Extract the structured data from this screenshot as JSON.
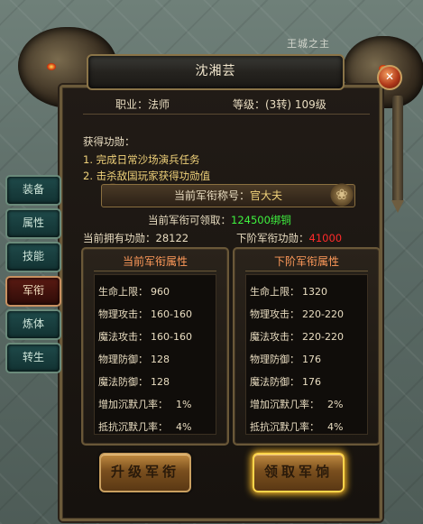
{
  "background": {
    "faint_text": "王城之主"
  },
  "window": {
    "title": "沈湘芸",
    "close_symbol": "✕"
  },
  "character": {
    "job_label": "职业：法师",
    "level_label": "等级：(3转) 109级"
  },
  "merit_gain": {
    "title": "获得功勋：",
    "items": [
      "1. 完成日常沙场演兵任务",
      "2. 击杀敌国玩家获得功勋值"
    ]
  },
  "rank": {
    "label": "当前军衔称号：",
    "value": "官大夫",
    "knot_symbol": "❀"
  },
  "claimable": {
    "label": "当前军衔可领取：",
    "value": "124500绑铜"
  },
  "merit": {
    "current_label": "当前拥有功勋：",
    "current_value": "28122",
    "next_label": "下阶军衔功勋：",
    "next_value": "41000"
  },
  "current_attrs": {
    "title": "当前军衔属性",
    "rows": [
      {
        "k": "生命上限：",
        "v": "960"
      },
      {
        "k": "物理攻击：",
        "v": "160-160"
      },
      {
        "k": "魔法攻击：",
        "v": "160-160"
      },
      {
        "k": "物理防御：",
        "v": "128"
      },
      {
        "k": "魔法防御：",
        "v": "128"
      },
      {
        "k": "增加沉默几率：",
        "v": "1%"
      },
      {
        "k": "抵抗沉默几率：",
        "v": "4%"
      }
    ]
  },
  "next_attrs": {
    "title": "下阶军衔属性",
    "rows": [
      {
        "k": "生命上限：",
        "v": "1320"
      },
      {
        "k": "物理攻击：",
        "v": "220-220"
      },
      {
        "k": "魔法攻击：",
        "v": "220-220"
      },
      {
        "k": "物理防御：",
        "v": "176"
      },
      {
        "k": "魔法防御：",
        "v": "176"
      },
      {
        "k": "增加沉默几率：",
        "v": "2%"
      },
      {
        "k": "抵抗沉默几率：",
        "v": "4%"
      }
    ]
  },
  "buttons": {
    "upgrade": "升级军衔",
    "claim": "领取军饷"
  },
  "side_tabs": [
    {
      "label": "装备"
    },
    {
      "label": "属性"
    },
    {
      "label": "技能"
    },
    {
      "label": "军衔",
      "active": true
    },
    {
      "label": "炼体"
    },
    {
      "label": "转生"
    }
  ],
  "colors": {
    "claim_value": "#3ff23f",
    "next_merit_value": "#ff2a2a",
    "rank_value": "#f0d27a",
    "attr_title": "#ff9a5a"
  }
}
